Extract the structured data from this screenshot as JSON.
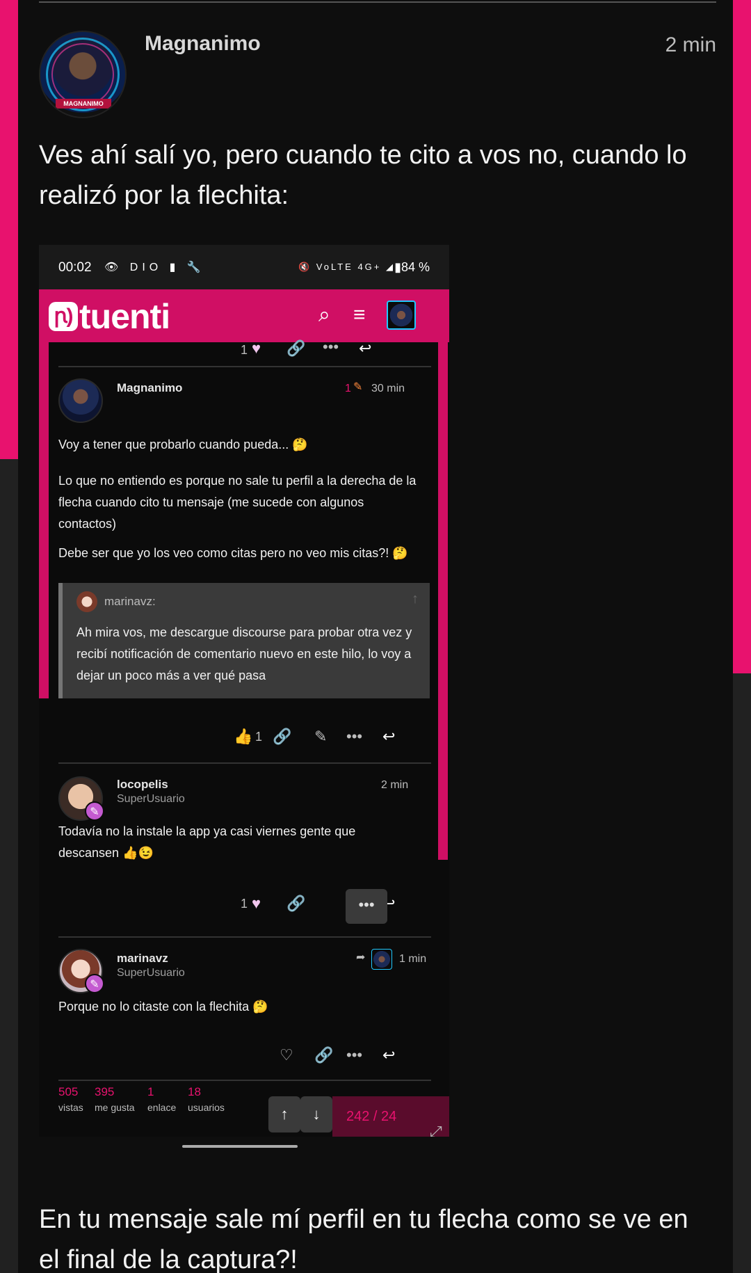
{
  "post": {
    "author": "Magnanimo",
    "avatar_tag": "MAGNANIMO",
    "time": "2 min",
    "text_before": "Ves ahí salí yo, pero cuando te cito a vos no, cuando lo realizó por la flechita:",
    "text_after": "En tu mensaje sale mí perfil en tu flecha como se ve en el final de la captura?!"
  },
  "screenshot": {
    "status": {
      "time": "00:02",
      "icons_left": "👁 DIO ▮ 🔧",
      "icons_right": "🔇 VoLTE 4G+ ◢",
      "battery": "▮84 %"
    },
    "app": {
      "logo_mark": "ꞃ)",
      "logo_text": "tuenti"
    },
    "top_actions": {
      "likes": "1"
    },
    "post1": {
      "author": "Magnanimo",
      "edits": "1",
      "time": "30 min",
      "text1": "Voy a tener que probarlo cuando pueda... 🤔",
      "text2": "Lo que no entiendo es porque no sale tu perfil a la derecha de la flecha cuando cito tu mensaje (me sucede con algunos contactos)",
      "text3": "Debe ser que yo los veo como citas pero no veo mis citas?! 🤔",
      "quote": {
        "author": "marinavz:",
        "text": "Ah mira vos, me descargue discourse para probar otra vez y recibí notificación de comentario nuevo en este hilo, lo voy a dejar un poco más a ver qué pasa"
      },
      "likes": "1"
    },
    "post2": {
      "author": "locopelis",
      "title": "SuperUsuario",
      "time": "2 min",
      "text": "Todavía no la instale la app ya casi viernes gente que descansen 👍😉",
      "likes": "1"
    },
    "post3": {
      "author": "marinavz",
      "title": "SuperUsuario",
      "time": "1 min",
      "text": "Porque no lo citaste con la flechita 🤔"
    },
    "stats": [
      {
        "number": "505",
        "label": "vistas"
      },
      {
        "number": "395",
        "label": "me gusta"
      },
      {
        "number": "1",
        "label": "enlace"
      },
      {
        "number": "18",
        "label": "usuarios"
      }
    ],
    "progress": "242 / 24"
  },
  "icons": {
    "heart": "♥",
    "heart_outline": "♡",
    "link": "🔗",
    "more": "•••",
    "reply": "↩",
    "pencil": "✎",
    "thumbs": "👍",
    "search": "⌕",
    "menu": "≡",
    "up": "↑",
    "down": "↓",
    "share": "➦",
    "up_arrow_light": "↑",
    "expand": "⤢",
    "badge": "✎"
  },
  "colors": {
    "accent": "#e8126e",
    "appbar": "#d00f64"
  }
}
